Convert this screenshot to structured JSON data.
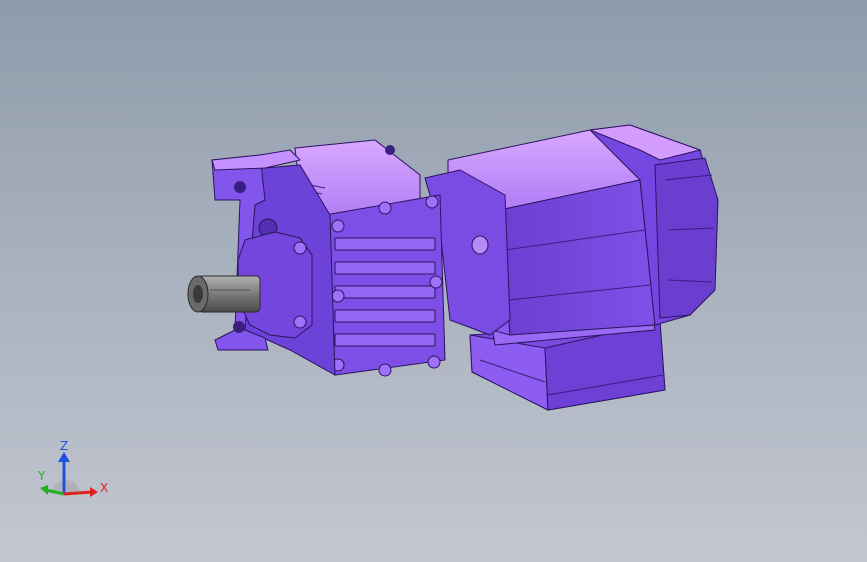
{
  "viewport": {
    "background_top": "#8f9bab",
    "background_bottom": "#c3c7d0"
  },
  "model": {
    "name_icon": "gear-motor-model",
    "body_color": "#7b4fe0",
    "highlight_color": "#c48cff",
    "shadow_color": "#4a2a9c",
    "shaft_color": "#8a8a8a"
  },
  "triad": {
    "x_label": "X",
    "y_label": "Y",
    "z_label": "Z",
    "x_color": "#e02020",
    "y_color": "#20b020",
    "z_color": "#2050e0"
  }
}
